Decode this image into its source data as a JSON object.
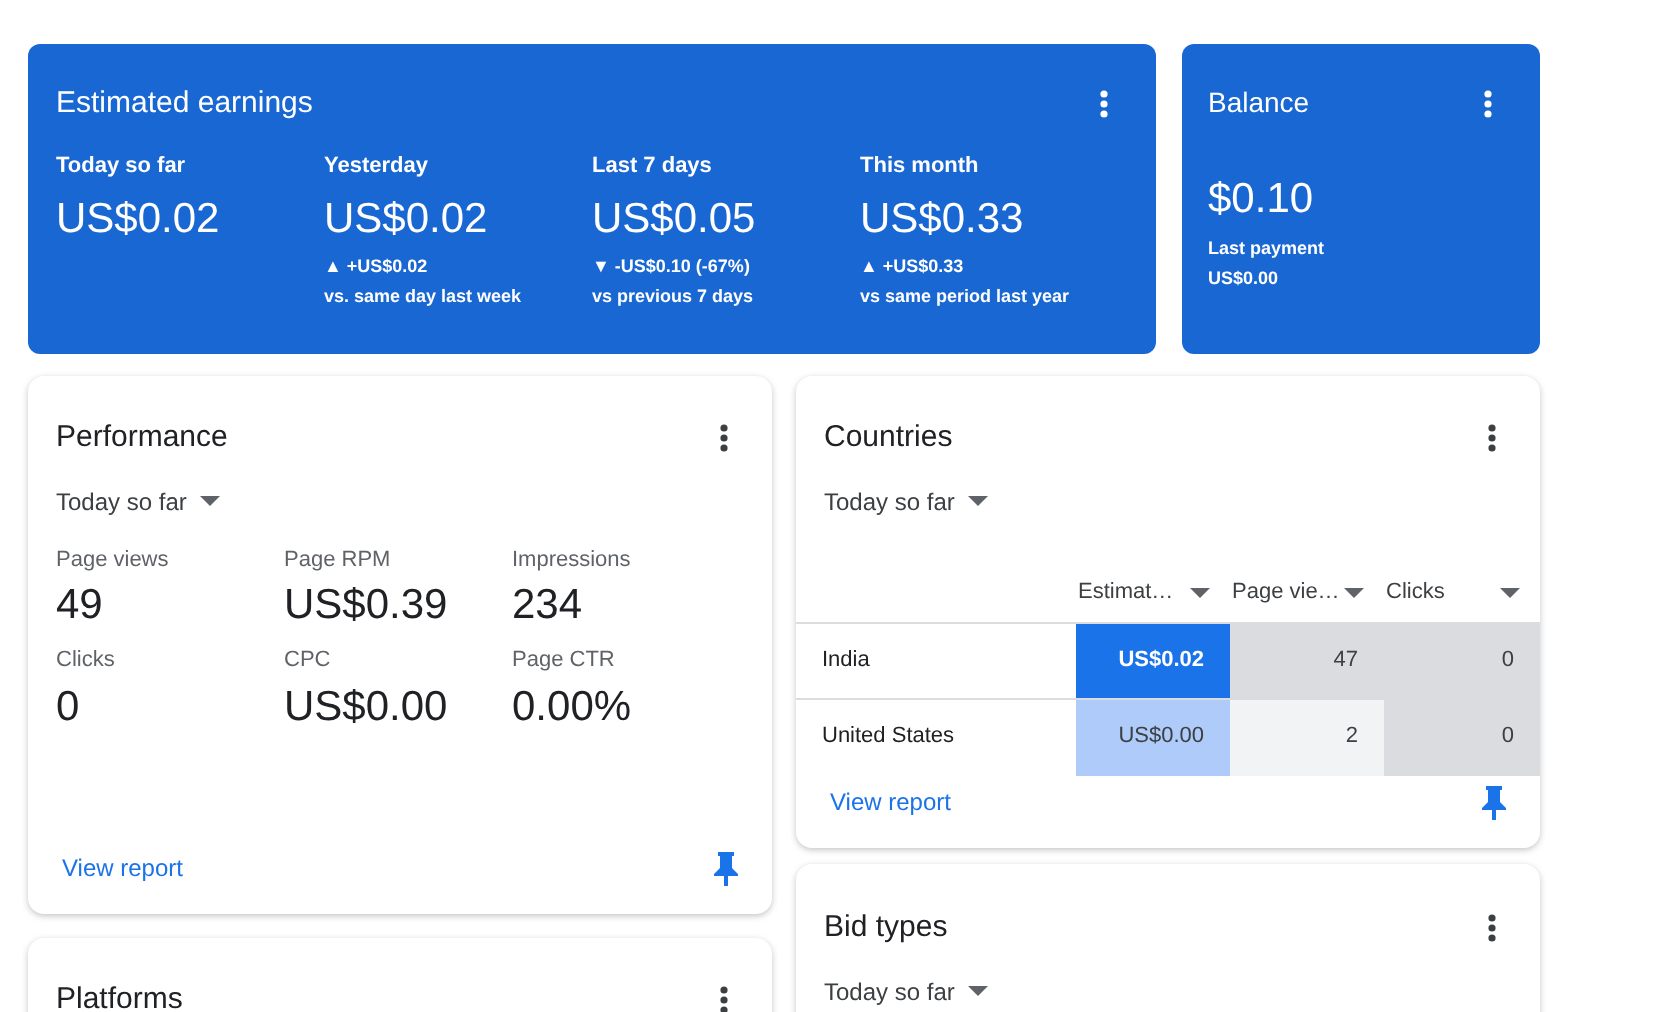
{
  "earnings": {
    "title": "Estimated earnings",
    "periods": [
      {
        "label": "Today so far",
        "value": "US$0.02"
      },
      {
        "label": "Yesterday",
        "value": "US$0.02",
        "change": "▲ +US$0.02",
        "comparison": "vs. same day last week"
      },
      {
        "label": "Last 7 days",
        "value": "US$0.05",
        "change": "▼ -US$0.10 (-67%)",
        "comparison": "vs previous 7 days"
      },
      {
        "label": "This month",
        "value": "US$0.33",
        "change": "▲ +US$0.33",
        "comparison": "vs same period last year"
      }
    ]
  },
  "balance": {
    "title": "Balance",
    "value": "$0.10",
    "last_payment_label": "Last payment",
    "last_payment": "US$0.00"
  },
  "performance": {
    "title": "Performance",
    "range": "Today so far",
    "metrics": [
      {
        "label": "Page views",
        "value": "49"
      },
      {
        "label": "Page RPM",
        "value": "US$0.39"
      },
      {
        "label": "Impressions",
        "value": "234"
      },
      {
        "label": "Clicks",
        "value": "0"
      },
      {
        "label": "CPC",
        "value": "US$0.00"
      },
      {
        "label": "Page CTR",
        "value": "0.00%"
      }
    ],
    "link": "View report"
  },
  "countries": {
    "title": "Countries",
    "range": "Today so far",
    "columns": [
      "Estimat…",
      "Page vie…",
      "Clicks"
    ],
    "rows": [
      {
        "name": "India",
        "cells": [
          {
            "text": "US$0.02",
            "color": "#1a73e8"
          },
          {
            "text": "47",
            "color": "#dadce0"
          },
          {
            "text": "0",
            "color": "#dadce0"
          }
        ]
      },
      {
        "name": "United States",
        "cells": [
          {
            "text": "US$0.00",
            "color": "#aecbfa"
          },
          {
            "text": "2",
            "color": "#f1f3f4"
          },
          {
            "text": "0",
            "color": "#dadce0"
          }
        ]
      }
    ],
    "link": "View report"
  },
  "platforms": {
    "title": "Platforms"
  },
  "bid_types": {
    "title": "Bid types",
    "range": "Today so far"
  }
}
